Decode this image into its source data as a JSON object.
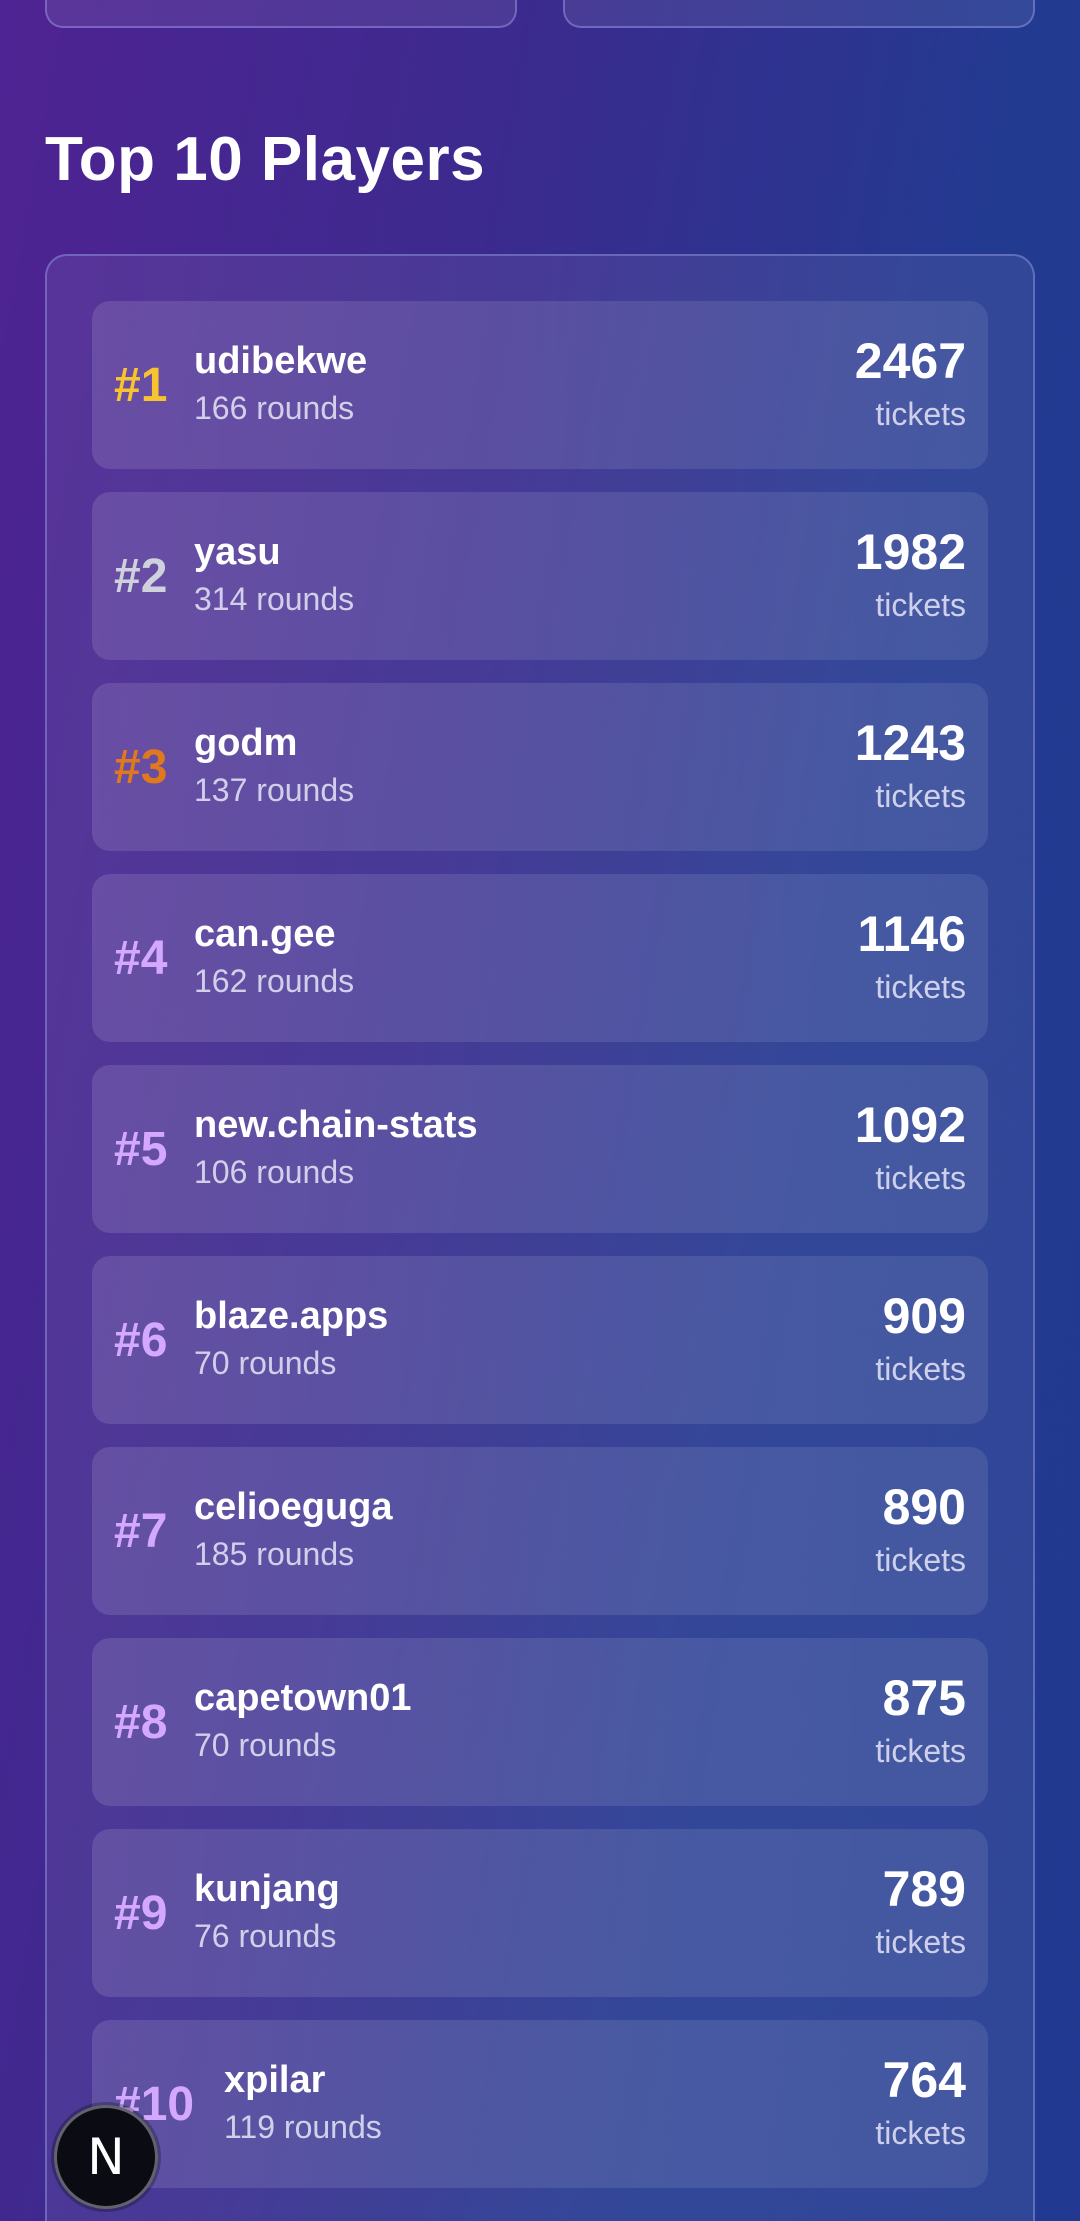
{
  "section_title": "Top 10 Players",
  "leaderboard": [
    {
      "rank": "#1",
      "name": "udibekwe",
      "rounds": "166 rounds",
      "tickets": "2467",
      "unit": "tickets"
    },
    {
      "rank": "#2",
      "name": "yasu",
      "rounds": "314 rounds",
      "tickets": "1982",
      "unit": "tickets"
    },
    {
      "rank": "#3",
      "name": "godm",
      "rounds": "137 rounds",
      "tickets": "1243",
      "unit": "tickets"
    },
    {
      "rank": "#4",
      "name": "can.gee",
      "rounds": "162 rounds",
      "tickets": "1146",
      "unit": "tickets"
    },
    {
      "rank": "#5",
      "name": "new.chain-stats",
      "rounds": "106 rounds",
      "tickets": "1092",
      "unit": "tickets"
    },
    {
      "rank": "#6",
      "name": "blaze.apps",
      "rounds": "70 rounds",
      "tickets": "909",
      "unit": "tickets"
    },
    {
      "rank": "#7",
      "name": "celioeguga",
      "rounds": "185 rounds",
      "tickets": "890",
      "unit": "tickets"
    },
    {
      "rank": "#8",
      "name": "capetown01",
      "rounds": "70 rounds",
      "tickets": "875",
      "unit": "tickets"
    },
    {
      "rank": "#9",
      "name": "kunjang",
      "rounds": "76 rounds",
      "tickets": "789",
      "unit": "tickets"
    },
    {
      "rank": "#10",
      "name": "xpilar",
      "rounds": "119 rounds",
      "tickets": "764",
      "unit": "tickets"
    }
  ],
  "rank_colors": {
    "first": "#f7c430",
    "second": "#cfd2dc",
    "third": "#e0781e",
    "other": "#d5a8ff"
  },
  "floating_badge": {
    "letter": "N"
  }
}
